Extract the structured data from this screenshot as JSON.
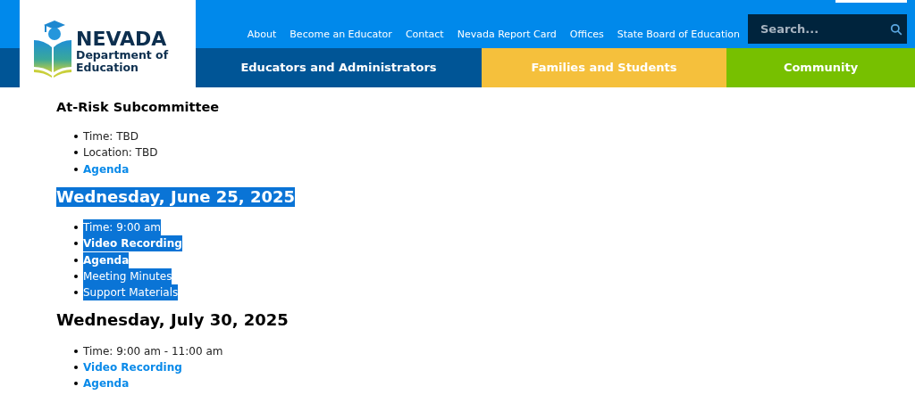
{
  "logo": {
    "title": "NEVADA",
    "subtitle": "Department of Education"
  },
  "top_links": [
    "About",
    "Become an Educator",
    "Contact",
    "Nevada Report Card",
    "Offices",
    "State Board of Education"
  ],
  "search": {
    "placeholder": "Search..."
  },
  "nav_tabs": [
    {
      "label": "Educators and Administrators",
      "color": "#005596"
    },
    {
      "label": "Families and Students",
      "color": "#f5c03c"
    },
    {
      "label": "Community",
      "color": "#77c000"
    }
  ],
  "sections": [
    {
      "heading": "At-Risk Subcommittee",
      "kind": "subheading",
      "highlighted": false,
      "items": [
        {
          "kind": "text",
          "text": "Time: TBD",
          "highlighted": false
        },
        {
          "kind": "text",
          "text": "Location: TBD",
          "highlighted": false
        },
        {
          "kind": "link",
          "text": "Agenda",
          "highlighted": false
        }
      ]
    },
    {
      "heading": "Wednesday, June 25, 2025",
      "kind": "date",
      "highlighted": true,
      "items": [
        {
          "kind": "text",
          "text": "Time: 9:00 am",
          "highlighted": true
        },
        {
          "kind": "link",
          "text": "Video Recording",
          "highlighted": true
        },
        {
          "kind": "link",
          "text": "Agenda",
          "highlighted": true
        },
        {
          "kind": "plainlink",
          "text": "Meeting Minutes",
          "highlighted": true
        },
        {
          "kind": "plainlink",
          "text": "Support Materials",
          "highlighted": true
        }
      ]
    },
    {
      "heading": "Wednesday, July 30, 2025",
      "kind": "date",
      "highlighted": false,
      "items": [
        {
          "kind": "text",
          "text": "Time: 9:00 am - 11:00 am",
          "highlighted": false
        },
        {
          "kind": "link",
          "text": "Video Recording",
          "highlighted": false
        },
        {
          "kind": "link",
          "text": "Agenda",
          "highlighted": false
        }
      ]
    }
  ]
}
